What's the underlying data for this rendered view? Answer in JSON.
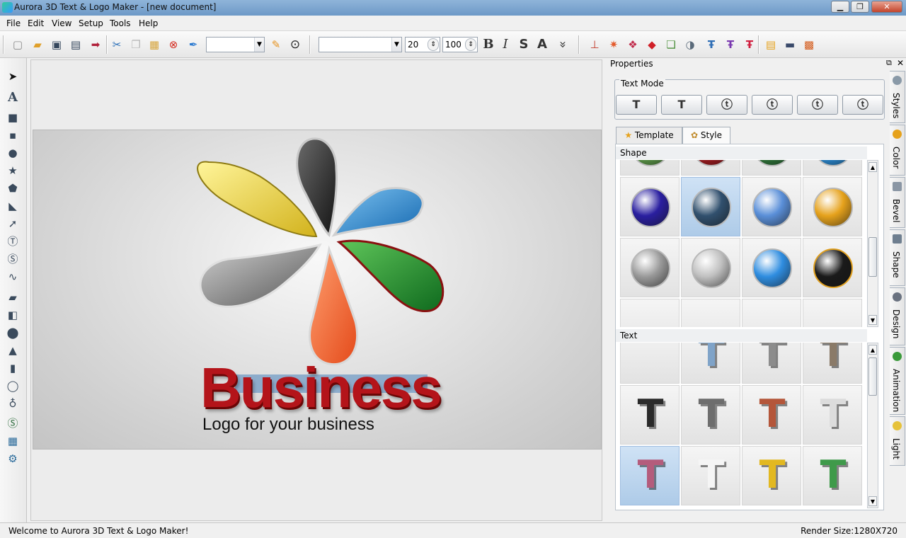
{
  "window": {
    "title": "Aurora 3D Text & Logo Maker - [new document]",
    "min_label": "▁",
    "max_label": "❐",
    "close_label": "✕"
  },
  "menu": [
    "File",
    "Edit",
    "View",
    "Setup",
    "Tools",
    "Help"
  ],
  "toolbar": {
    "font_combo_value": "",
    "font_name_value": "",
    "font_size_value": "20",
    "scale_value": "100",
    "bold_label": "B",
    "italic_label": "I",
    "strike_label": "S",
    "outline_label": "A",
    "more_label": "»"
  },
  "canvas": {
    "logo_title": "Business",
    "logo_subtitle": "Logo for your business"
  },
  "properties": {
    "title": "Properties",
    "text_mode_label": "Text Mode",
    "tabs": [
      "Template",
      "Style"
    ],
    "active_tab": "Style",
    "shape_section_label": "Shape",
    "text_section_label": "Text",
    "shape_colors": {
      "row0": [
        "#5fa04a",
        "#a8191e",
        "#2f7a3a",
        "#2a8fdc"
      ],
      "row1": [
        "#2a1fa0",
        "#31506e",
        "#5a8fd8",
        "#e6a21c"
      ],
      "row2": [
        "#9a9a9a",
        "#c0c0c0",
        "#2f8de0",
        "#1a1a1a"
      ],
      "selected_shape_index": 5
    },
    "text_styles": {
      "row0": [
        "#e0e0e0",
        "#7fa3c8",
        "#8c8c8c",
        "#8a7a68"
      ],
      "row1": [
        "#2a2a2a",
        "#6d6d6d",
        "#b4563a",
        "#dcdcdc"
      ],
      "row2": [
        "#b45c7c",
        "#f5f5f5",
        "#e2b820",
        "#3f9a4a"
      ],
      "selected_text_index": 8
    }
  },
  "side_tabs": [
    "Styles",
    "Color",
    "Bevel",
    "Shape",
    "Design",
    "Animation",
    "Light"
  ],
  "status": {
    "left": "Welcome to Aurora 3D Text & Logo Maker!",
    "right": "Render Size:1280X720"
  }
}
